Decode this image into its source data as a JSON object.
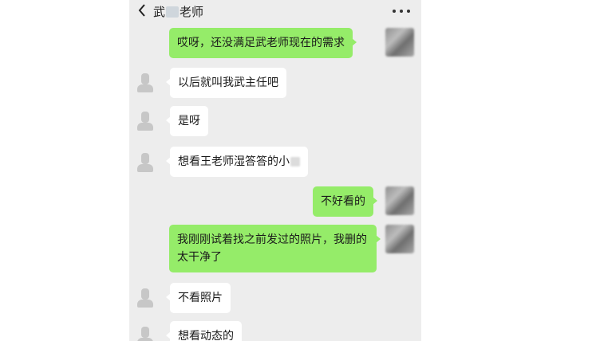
{
  "header": {
    "back_icon": "chevron-left-icon",
    "title_prefix": "武",
    "title_suffix": "老师",
    "more_icon": "more-dots-icon"
  },
  "messages": [
    {
      "side": "right",
      "text": "哎呀，还没满足武老师现在的需求"
    },
    {
      "side": "left",
      "text": "以后就叫我武主任吧"
    },
    {
      "side": "left",
      "text": "是呀"
    },
    {
      "side": "left",
      "text": "想看王老师湿答答的小"
    },
    {
      "side": "right",
      "text": "不好看的"
    },
    {
      "side": "right",
      "text": "我刚刚试着找之前发过的照片，我删的太干净了"
    },
    {
      "side": "left",
      "text": "不看照片"
    },
    {
      "side": "left",
      "text": "想看动态的"
    }
  ],
  "colors": {
    "background": "#ededed",
    "sent_bubble": "#95ec69",
    "received_bubble": "#ffffff"
  }
}
